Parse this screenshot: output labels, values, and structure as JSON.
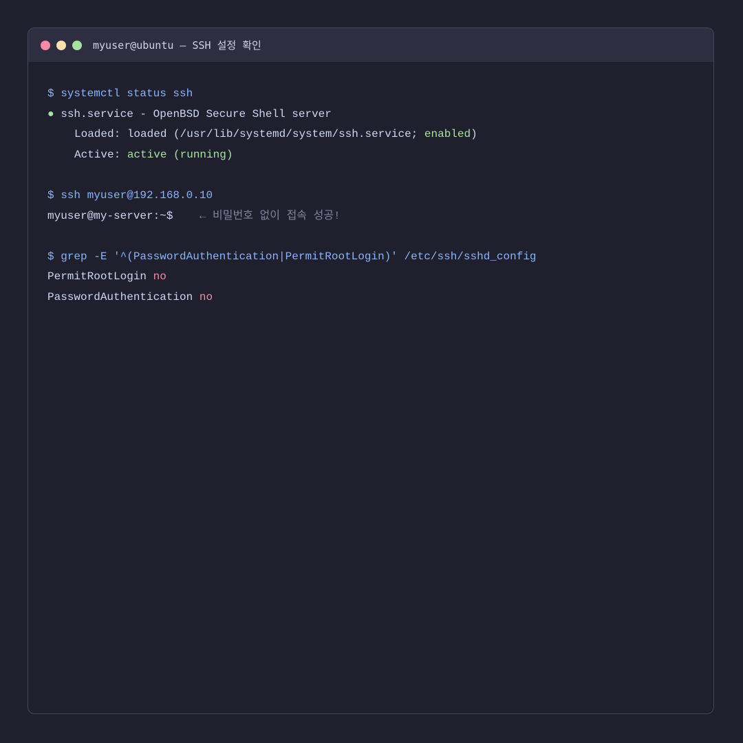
{
  "window": {
    "title": "myuser@ubuntu — SSH 설정 확인",
    "controls": {
      "close_color": "#f38ba8",
      "minimize_color": "#f9e2af",
      "maximize_color": "#a6e3a1"
    }
  },
  "colors": {
    "background": "#1f1f2d",
    "titlebar": "#2e2e40",
    "command": "#89b4fa",
    "success": "#a6e3a1",
    "error": "#f38ba8",
    "text": "#cdd6f4",
    "comment": "#7f849c"
  },
  "terminal": {
    "block1": {
      "command": "$ systemctl status ssh",
      "bullet": "●",
      "service_line": " ssh.service - OpenBSD Secure Shell server",
      "loaded_prefix": "Loaded: loaded (/usr/lib/systemd/system/ssh.service; ",
      "loaded_state": "enabled",
      "loaded_suffix": ")",
      "active_prefix": "Active: ",
      "active_state": "active (running)"
    },
    "block2": {
      "command": "$ ssh myuser@192.168.0.10",
      "prompt": "myuser@my-server:~$",
      "comment": "    ← 비밀번호 없이 접속 성공!"
    },
    "block3": {
      "command": "$ grep -E '^(PasswordAuthentication|PermitRootLogin)' /etc/ssh/sshd_config",
      "line1_key": "PermitRootLogin ",
      "line1_value": "no",
      "line2_key": "PasswordAuthentication ",
      "line2_value": "no"
    }
  }
}
